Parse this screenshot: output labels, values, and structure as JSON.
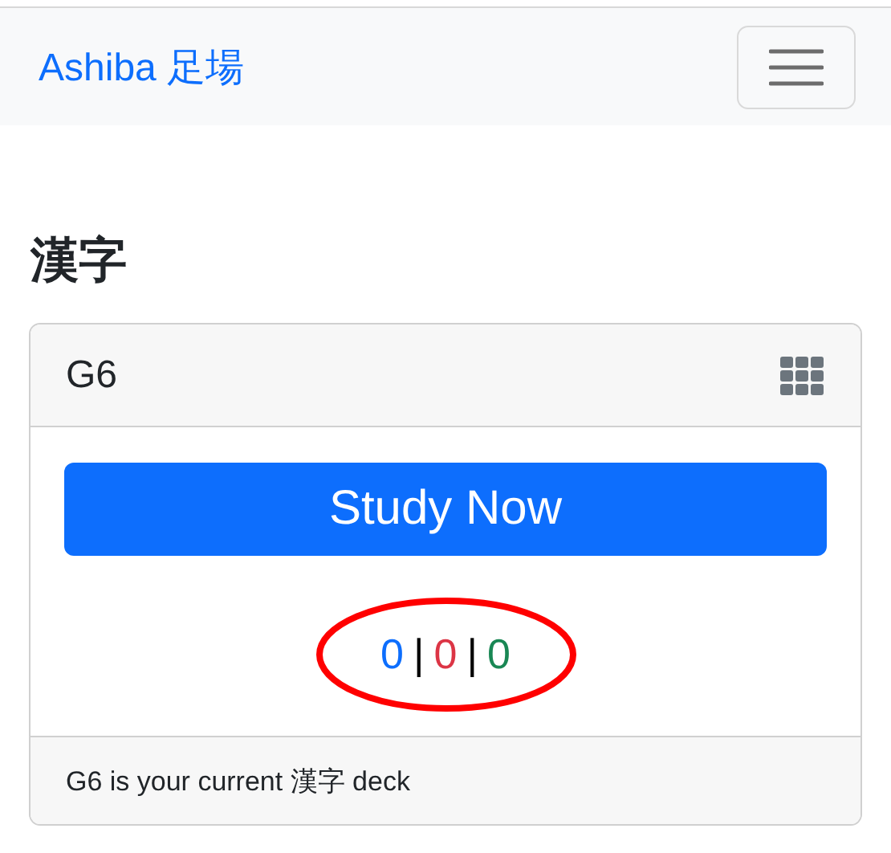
{
  "navbar": {
    "brand": "Ashiba 足場",
    "menu_expanded": false
  },
  "heading": "漢字",
  "deck_card": {
    "header": "G6",
    "button": "Study Now",
    "counts": [
      {
        "value": "0",
        "color": "#0d6efd"
      },
      {
        "value": "0",
        "color": "#dc3545"
      },
      {
        "value": "0",
        "color": "#198754"
      }
    ],
    "separator": "|",
    "highlighted": true,
    "footer": "G6 is your current 漢字 deck"
  }
}
